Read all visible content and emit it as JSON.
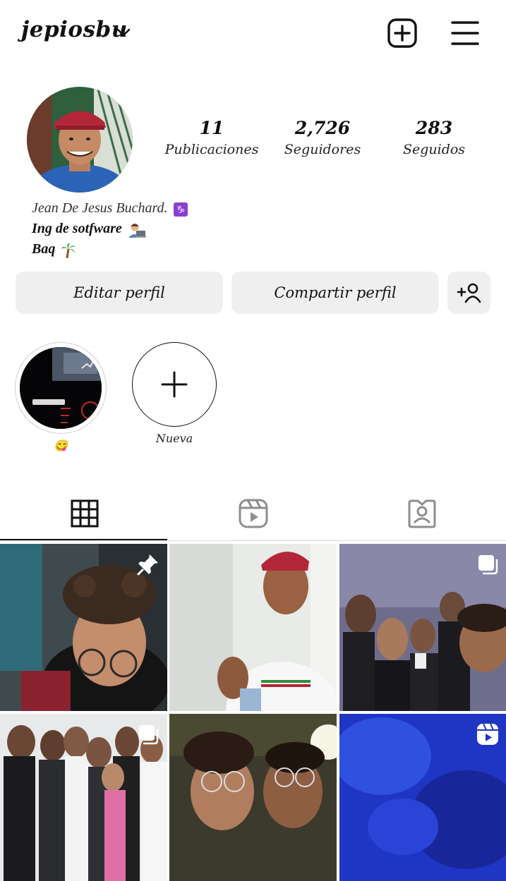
{
  "header": {
    "username": "jepiosbu",
    "new_post_icon": "plus-square-icon",
    "menu_icon": "hamburger-menu-icon"
  },
  "profile": {
    "stats": [
      {
        "value": "11",
        "label": "Publicaciones"
      },
      {
        "value": "2,726",
        "label": "Seguidores"
      },
      {
        "value": "283",
        "label": "Seguidos"
      }
    ],
    "bio": {
      "name": "Jean De Jesus Buchard.",
      "line1": "Ing de sotfware",
      "line2": "Baq"
    }
  },
  "buttons": {
    "edit": "Editar perfil",
    "share": "Compartir perfil",
    "add_person_icon": "add-person-icon"
  },
  "highlights": [
    {
      "label": "😋"
    },
    {
      "label": "Nueva"
    }
  ],
  "tabs": [
    {
      "icon": "grid-icon",
      "active": true
    },
    {
      "icon": "reels-icon",
      "active": false
    },
    {
      "icon": "tagged-icon",
      "active": false
    }
  ],
  "colors": {
    "button_bg": "#efefef",
    "text": "#111111",
    "divider": "#dbdbdb"
  }
}
